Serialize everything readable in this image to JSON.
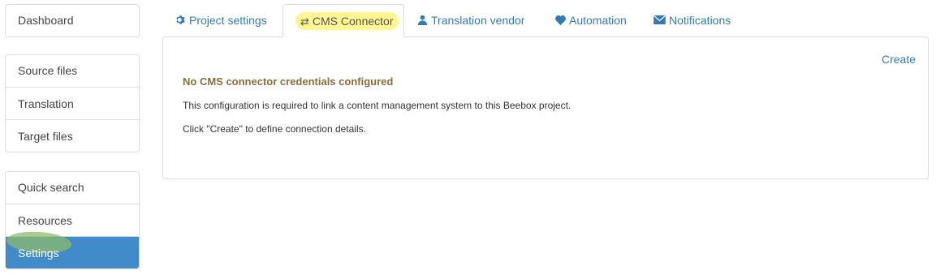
{
  "sidebar": {
    "group1": [
      {
        "label": "Dashboard"
      }
    ],
    "group2": [
      {
        "label": "Source files"
      },
      {
        "label": "Translation"
      },
      {
        "label": "Target files"
      }
    ],
    "group3": [
      {
        "label": "Quick search"
      },
      {
        "label": "Resources"
      },
      {
        "label": "Settings",
        "active": true
      }
    ]
  },
  "tabs": [
    {
      "label": "Project settings",
      "icon": "gear-icon"
    },
    {
      "label": "CMS Connector",
      "icon": "exchange-icon",
      "active": true
    },
    {
      "label": "Translation vendor",
      "icon": "user-icon"
    },
    {
      "label": "Automation",
      "icon": "heart-icon"
    },
    {
      "label": "Notifications",
      "icon": "envelope-icon"
    }
  ],
  "panel": {
    "create_label": "Create",
    "title": "No CMS connector credentials configured",
    "line1": "This configuration is required to link a content management system to this Beebox project.",
    "line2": "Click \"Create\" to define connection details."
  },
  "colors": {
    "accent": "#337ab7",
    "active_bg": "#428bca",
    "warning_text": "#8a6d3b",
    "tab_highlight": "#fff58c",
    "settings_highlight": "#8cb96e"
  }
}
